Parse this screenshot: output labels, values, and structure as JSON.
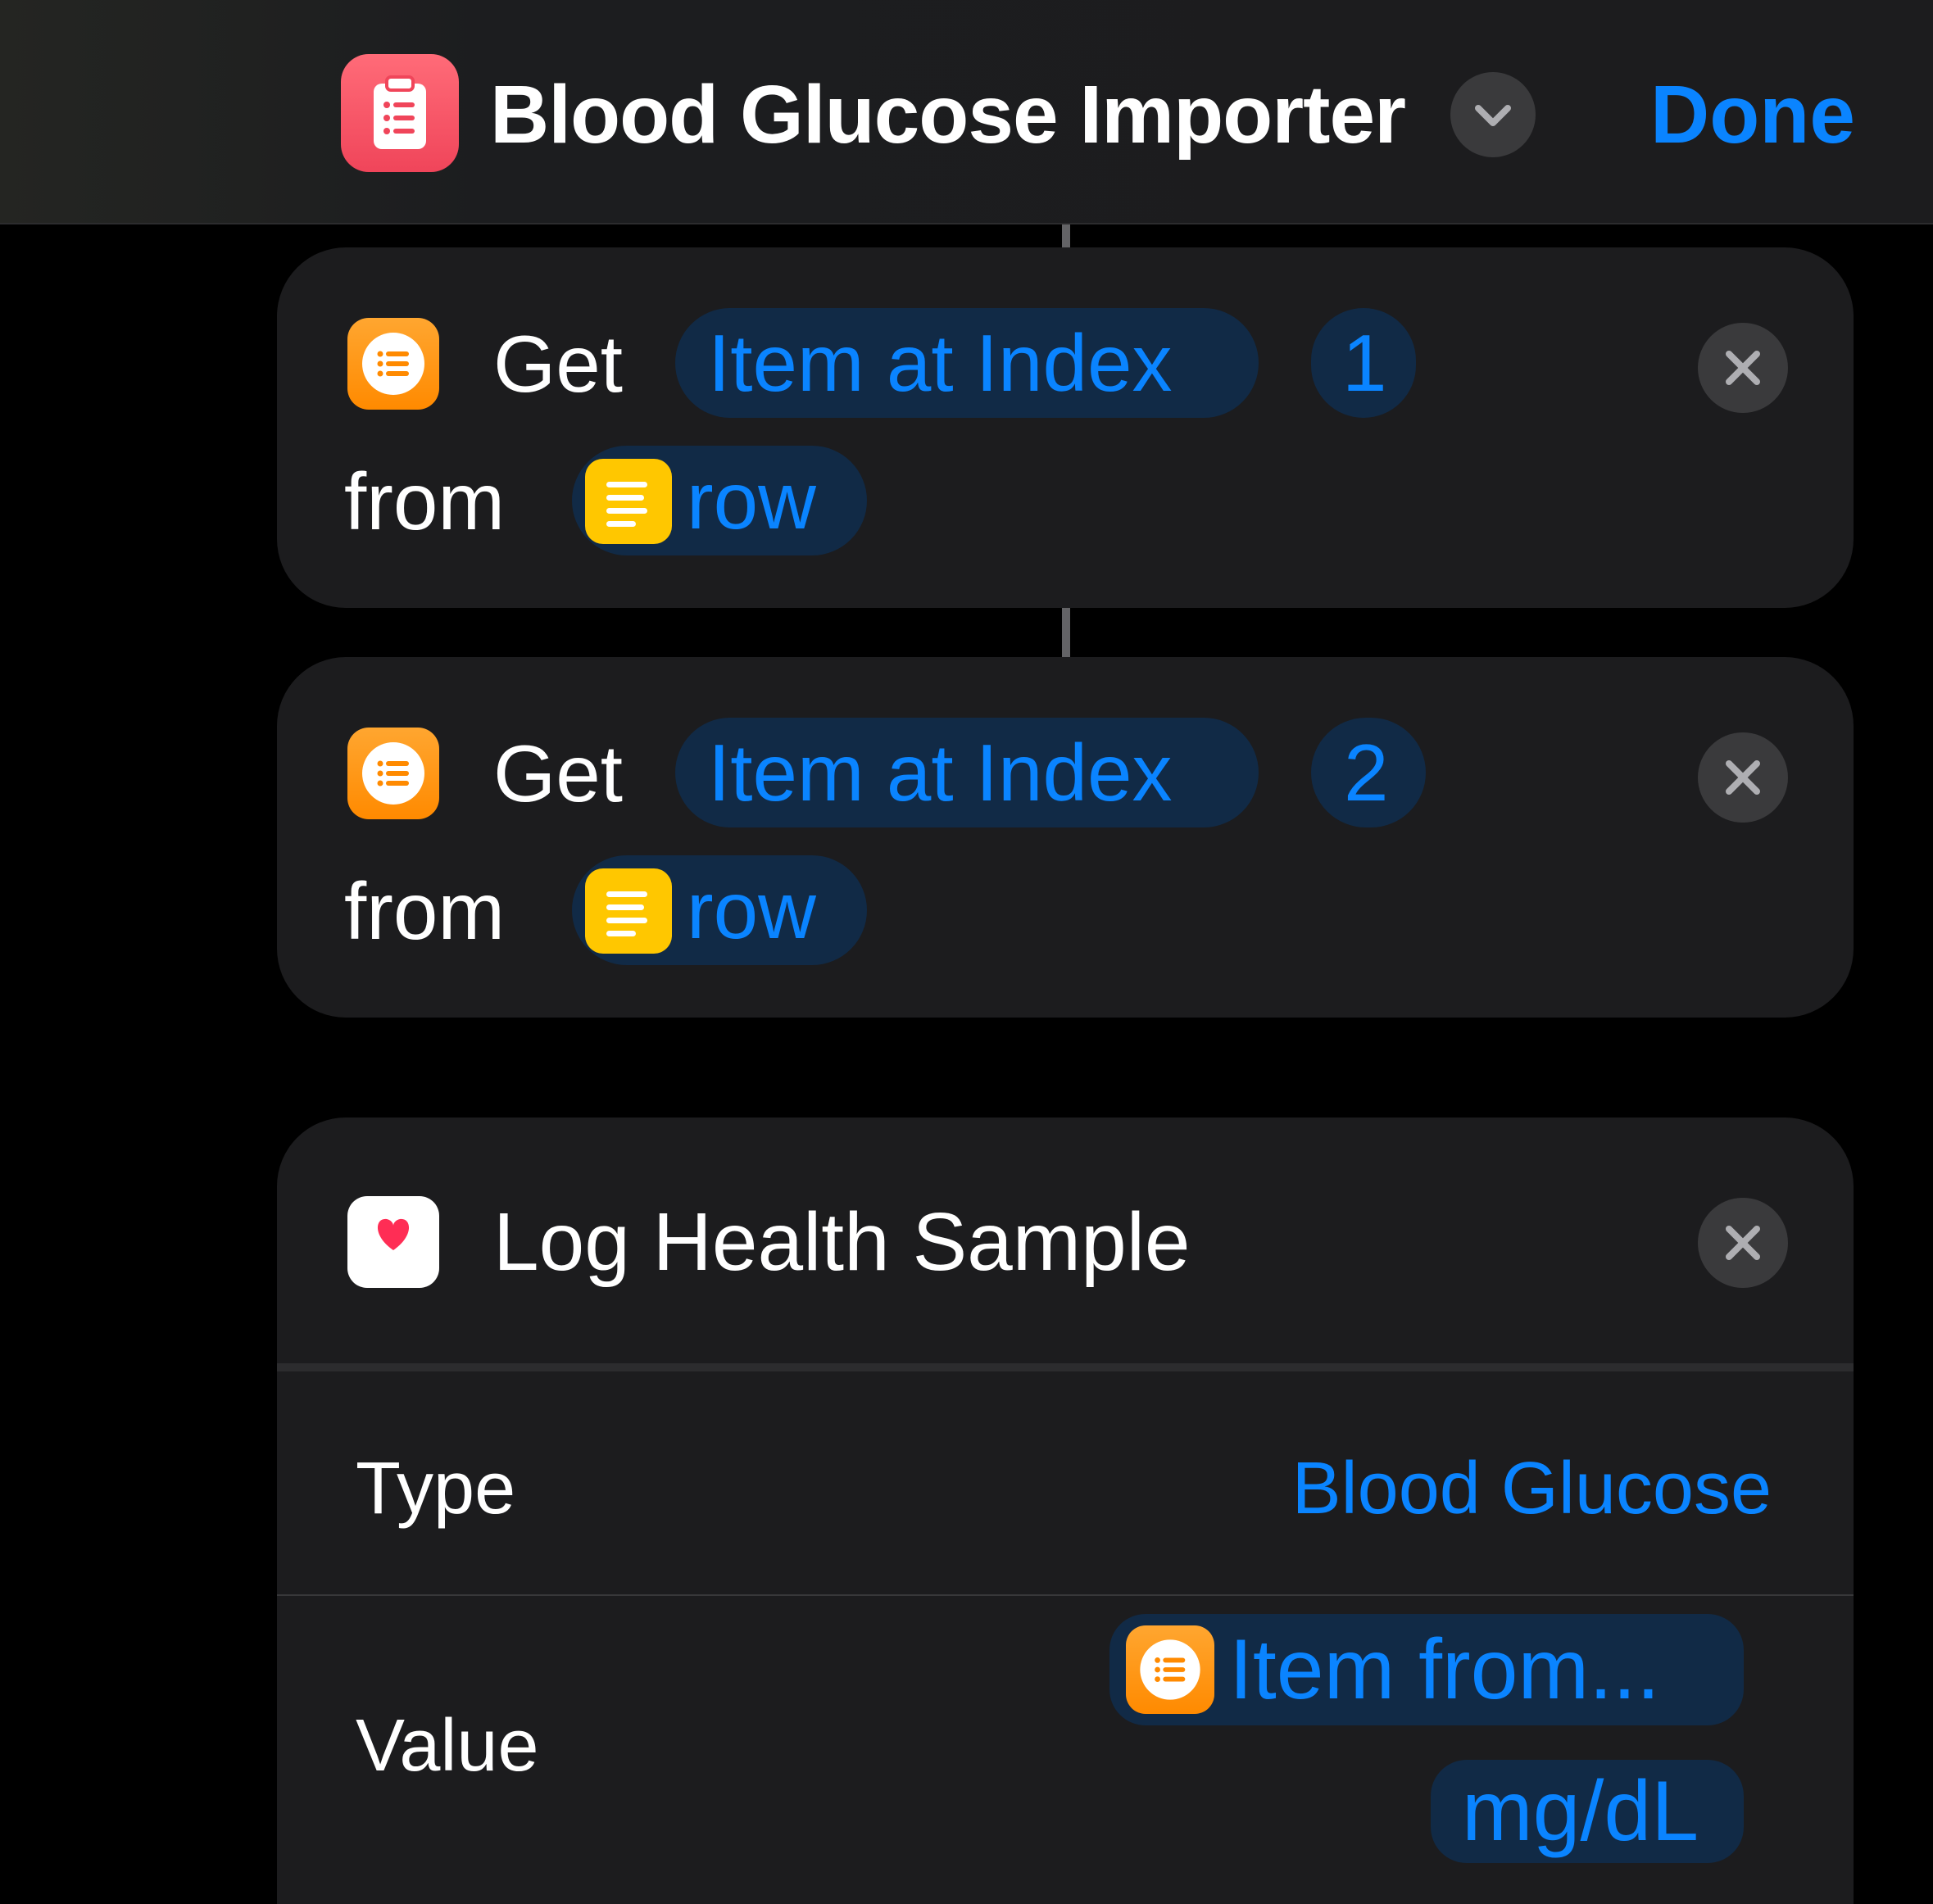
{
  "header": {
    "title": "Blood Glucose Importer",
    "done_label": "Done",
    "app_icon": "clipboard-list-icon",
    "app_icon_color": "#f0455a",
    "accent_color": "#0a84ff"
  },
  "actions": [
    {
      "icon": "list-icon",
      "verb": "Get",
      "parameter": "Item at Index",
      "index": "1",
      "preposition": "from",
      "variable": "row",
      "variable_icon": "text-lines-icon"
    },
    {
      "icon": "list-icon",
      "verb": "Get",
      "parameter": "Item at Index",
      "index": "2",
      "preposition": "from",
      "variable": "row",
      "variable_icon": "text-lines-icon"
    }
  ],
  "log_health": {
    "icon": "heart-icon",
    "title": "Log Health Sample",
    "rows": {
      "type_label": "Type",
      "type_value": "Blood Glucose",
      "value_label": "Value",
      "value_variable": "Item from...",
      "value_unit": "mg/dL"
    }
  }
}
